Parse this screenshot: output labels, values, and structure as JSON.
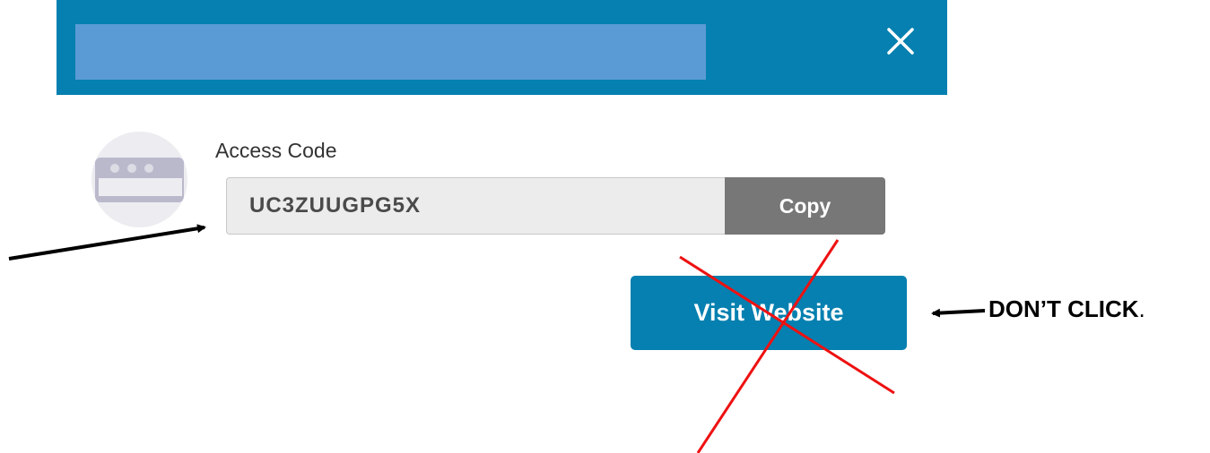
{
  "dialog": {
    "close_glyph": "✕",
    "access_code": {
      "label": "Access Code",
      "value": "UC3ZUUGPG5X",
      "copy_label": "Copy"
    },
    "visit_label": "Visit Website"
  },
  "annotations": {
    "dont_click_label": "DON’T CLICK",
    "dont_click_suffix": "."
  },
  "colors": {
    "header": "#0580b0",
    "title_placeholder": "#5b9bd5",
    "copy_button": "#777777",
    "visit_button": "#0580b0",
    "cross_mark": "#ee1111",
    "avatar_bg": "#ececf1",
    "avatar_icon": "#bab9cc"
  },
  "icons": {
    "close": "close-icon",
    "avatar": "browser-window-icon",
    "cross": "cross-out-mark"
  }
}
